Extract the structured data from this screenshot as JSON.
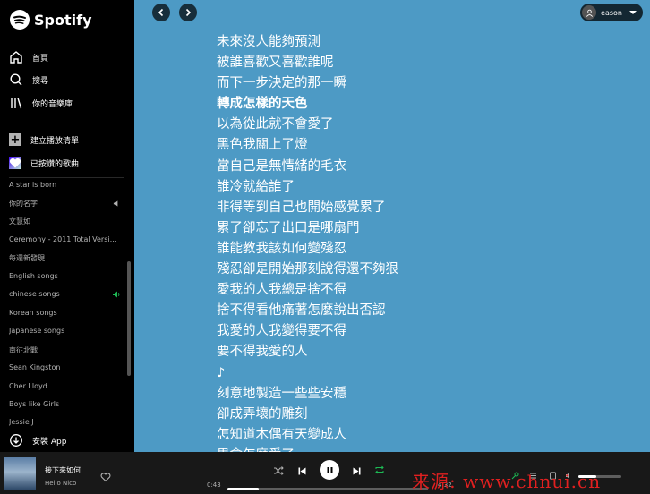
{
  "brand": {
    "name": "Spotify",
    "color": "#1db954"
  },
  "sidebar": {
    "nav": [
      {
        "label": "首頁",
        "icon": "home-icon"
      },
      {
        "label": "搜尋",
        "icon": "search-icon"
      },
      {
        "label": "你的音樂庫",
        "icon": "library-icon"
      }
    ],
    "create_playlist": "建立播放清單",
    "liked_songs": "已按讚的歌曲",
    "playlists": [
      "A star is born",
      "你的名字",
      "文慧如",
      "Ceremony - 2011 Total Versi…",
      "每週新發現",
      "English songs",
      "chinese songs",
      "Korean songs",
      "Japanese songs",
      "南征北戰",
      "Sean Kingston",
      "Cher Lloyd",
      "Boys like Girls",
      "Jessie J"
    ],
    "install_app": "安裝 App"
  },
  "topbar": {
    "username": "eason"
  },
  "lyrics": {
    "current_index": 3,
    "lines": [
      "未來沒人能夠預測",
      "被誰喜歡又喜歡誰呢",
      "而下一步決定的那一瞬",
      "轉成怎樣的天色",
      "以為從此就不會愛了",
      "黑色我關上了燈",
      "當自己是無情緒的毛衣",
      "誰冷就給誰了",
      "非得等到自己也開始感覺累了",
      "累了卻忘了出口是哪扇門",
      "誰能教我該如何變殘忍",
      "殘忍卻是開始那刻說得還不夠狠",
      "愛我的人我總是捨不得",
      "捨不得看他痛著怎麼說出否認",
      "我愛的人我變得要不得",
      "要不得我愛的人",
      "♪",
      "刻意地製造一些些安穩",
      "卻成弄壞的雕刻",
      "怎知道木偶有天變成人",
      "界會怎麼愛了"
    ]
  },
  "player": {
    "title": "接下來如何",
    "artist": "Hello Nico",
    "elapsed": "0:43",
    "duration": "4:32",
    "progress_fraction": 0.158,
    "volume_fraction": 0.42
  },
  "watermark": "来源: www.chnui.cn",
  "colors": {
    "main_bg": "#4d9ac5",
    "sidebar_bg": "#000000",
    "player_bg": "#181818",
    "accent": "#1db954"
  }
}
